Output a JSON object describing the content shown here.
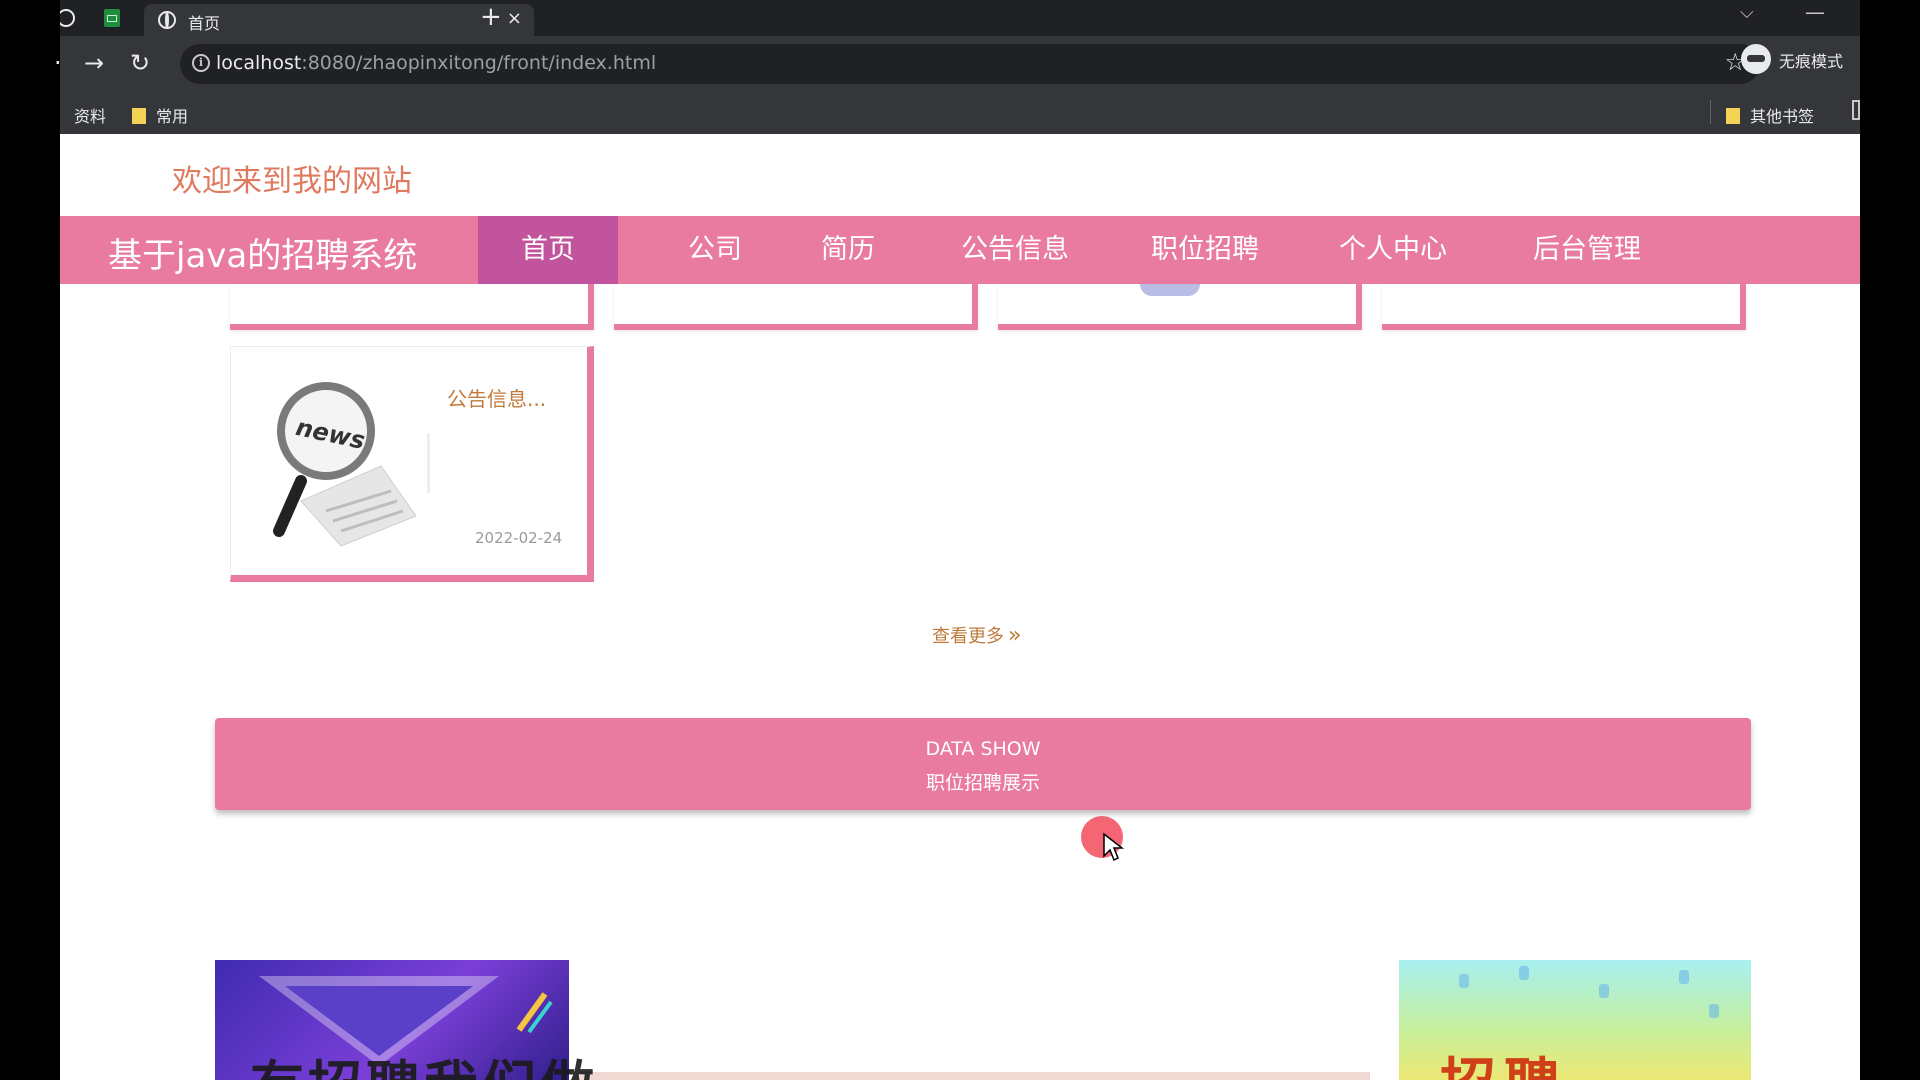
{
  "browser": {
    "tab_title": "首页",
    "tab_close": "×",
    "new_tab": "+",
    "url_host": "localhost",
    "url_path": ":8080/zhaopinxitong/front/index.html",
    "profile_label": "无痕模式",
    "bookmarks": [
      "资料",
      "常用"
    ],
    "other_bookmarks": "其他书签"
  },
  "site": {
    "welcome": "欢迎来到我的网站",
    "brand": "基于java的招聘系统",
    "nav": [
      "首页",
      "公司",
      "简历",
      "公告信息",
      "职位招聘",
      "个人中心",
      "后台管理"
    ],
    "active_nav": "首页"
  },
  "news": {
    "title": "公告信息...",
    "date": "2022-02-24",
    "image_label": "news"
  },
  "more_link": "查看更多",
  "data_show": {
    "en": "DATA SHOW",
    "cn": "职位招聘展示"
  },
  "bottom_partial_text": {
    "left": "有招聘我们做",
    "right": "招聘"
  },
  "colors": {
    "accent": "#e97aa0",
    "nav_active": "#c1549d",
    "welcome": "#e07a5f",
    "link": "#c07a3c"
  }
}
